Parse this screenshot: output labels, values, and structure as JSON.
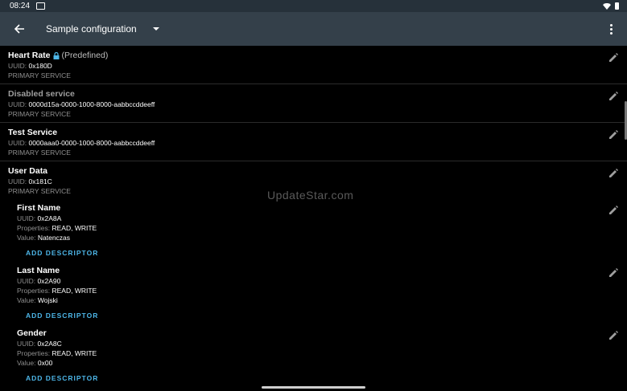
{
  "status_bar": {
    "time": "08:24"
  },
  "app_bar": {
    "title": "Sample configuration"
  },
  "services": [
    {
      "name": "Heart Rate",
      "predefined": "(Predefined)",
      "uuid_label": "UUID:",
      "uuid": "0x180D",
      "type": "PRIMARY SERVICE"
    },
    {
      "name": "Disabled service",
      "uuid_label": "UUID:",
      "uuid": "0000d15a-0000-1000-8000-aabbccddeeff",
      "type": "PRIMARY SERVICE"
    },
    {
      "name": "Test Service",
      "uuid_label": "UUID:",
      "uuid": "0000aaa0-0000-1000-8000-aabbccddeeff",
      "type": "PRIMARY SERVICE"
    },
    {
      "name": "User Data",
      "uuid_label": "UUID:",
      "uuid": "0x181C",
      "type": "PRIMARY SERVICE",
      "characteristics": [
        {
          "name": "First Name",
          "uuid_label": "UUID:",
          "uuid": "0x2A8A",
          "properties_label": "Properties:",
          "properties": "READ, WRITE",
          "value_label": "Value:",
          "value": "Natenczas",
          "add_descriptor": "ADD DESCRIPTOR"
        },
        {
          "name": "Last Name",
          "uuid_label": "UUID:",
          "uuid": "0x2A90",
          "properties_label": "Properties:",
          "properties": "READ, WRITE",
          "value_label": "Value:",
          "value": "Wojski",
          "add_descriptor": "ADD DESCRIPTOR"
        },
        {
          "name": "Gender",
          "uuid_label": "UUID:",
          "uuid": "0x2A8C",
          "properties_label": "Properties:",
          "properties": "READ, WRITE",
          "value_label": "Value:",
          "value": "0x00",
          "add_descriptor": "ADD DESCRIPTOR"
        }
      ]
    }
  ],
  "watermark": "UpdateStar.com",
  "colors": {
    "app_bar": "#34404a",
    "status_bar": "#26313a",
    "accent": "#4db6e8",
    "background": "#000000"
  },
  "icons": [
    "back-arrow-icon",
    "dropdown-caret-icon",
    "more-vert-icon",
    "edit-pencil-icon",
    "lock-icon"
  ]
}
